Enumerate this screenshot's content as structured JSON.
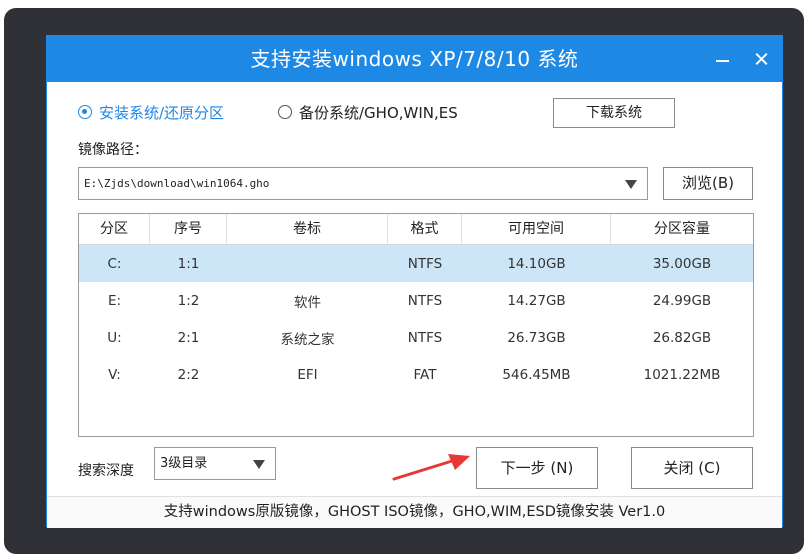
{
  "window": {
    "title": "支持安装windows XP/7/8/10 系统",
    "minimize_icon": "minimize-icon",
    "close_icon": "close-icon"
  },
  "options": {
    "install": {
      "label": "安装系统/还原分区",
      "checked": true
    },
    "backup": {
      "label": "备份系统/GHO,WIN,ES",
      "checked": false
    },
    "download_label": "下载系统"
  },
  "image_path": {
    "label": "镜像路径：",
    "value": "E:\\Zjds\\download\\win1064.gho",
    "browse_label": "浏览(B)"
  },
  "partitions": {
    "headers": [
      "分区",
      "序号",
      "卷标",
      "格式",
      "可用空间",
      "分区容量"
    ],
    "rows": [
      [
        "C:",
        "1:1",
        "",
        "NTFS",
        "14.10GB",
        "35.00GB"
      ],
      [
        "E:",
        "1:2",
        "软件",
        "NTFS",
        "14.27GB",
        "24.99GB"
      ],
      [
        "U:",
        "2:1",
        "系统之家",
        "NTFS",
        "26.73GB",
        "26.82GB"
      ],
      [
        "V:",
        "2:2",
        "EFI",
        "FAT",
        "546.45MB",
        "1021.22MB"
      ]
    ],
    "selected_row": "C:"
  },
  "search": {
    "label": "搜索深度",
    "value": "3级目录"
  },
  "actions": {
    "next_label": "下一步 (N)",
    "close_label": "关闭 (C)"
  },
  "footer": {
    "text": "支持windows原版镜像，GHOST ISO镜像，GHO,WIM,ESD镜像安装 Ver1.0"
  },
  "colors": {
    "accent": "#1e88e5",
    "selected_row": "#cde6f7",
    "annotation_arrow": "#e53935"
  }
}
